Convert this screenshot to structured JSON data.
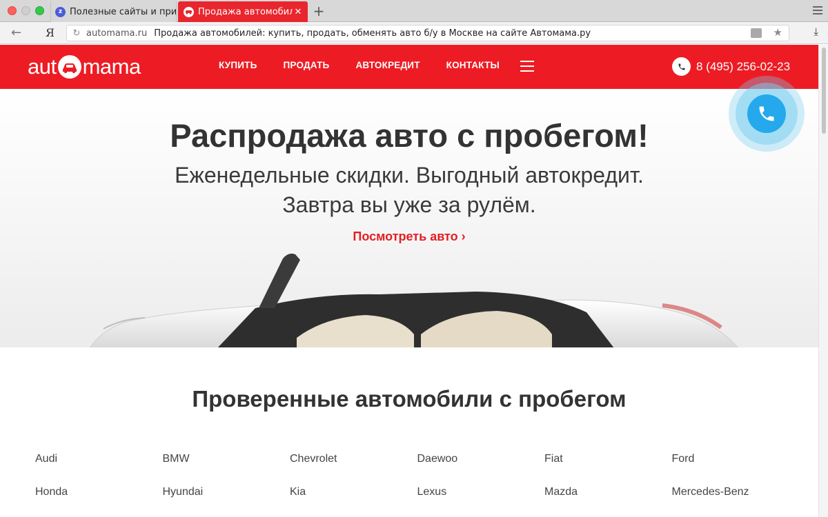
{
  "browser": {
    "tabs": [
      {
        "title": "Полезные сайты и прило",
        "active": false,
        "icon": "z-icon"
      },
      {
        "title": "Продажа автомобилей",
        "active": true,
        "icon": "car-icon"
      }
    ],
    "new_tab_symbol": "+",
    "yandex_symbol": "Я",
    "url_domain": "automama.ru",
    "url_title": "Продажа автомобилей: купить, продать, обменять авто б/у в Москве на сайте Автомама.ру"
  },
  "header": {
    "logo_left": "aut",
    "logo_right": "mama",
    "nav": [
      "КУПИТЬ",
      "ПРОДАТЬ",
      "АВТОКРЕДИТ",
      "КОНТАКТЫ"
    ],
    "phone": "8 (495) 256-02-23"
  },
  "hero": {
    "title": "Распродажа авто с пробегом!",
    "subtitle_line1": "Еженедельные скидки. Выгодный автокредит.",
    "subtitle_line2": "Завтра вы уже за рулём.",
    "link": "Посмотреть авто ›"
  },
  "section": {
    "title": "Проверенные автомобили с пробегом",
    "brands": [
      "Audi",
      "BMW",
      "Chevrolet",
      "Daewoo",
      "Fiat",
      "Ford",
      "Honda",
      "Hyundai",
      "Kia",
      "Lexus",
      "Mazda",
      "Mercedes-Benz"
    ]
  },
  "colors": {
    "brand_red": "#ed1c24",
    "call_blue": "#25a9ec"
  }
}
